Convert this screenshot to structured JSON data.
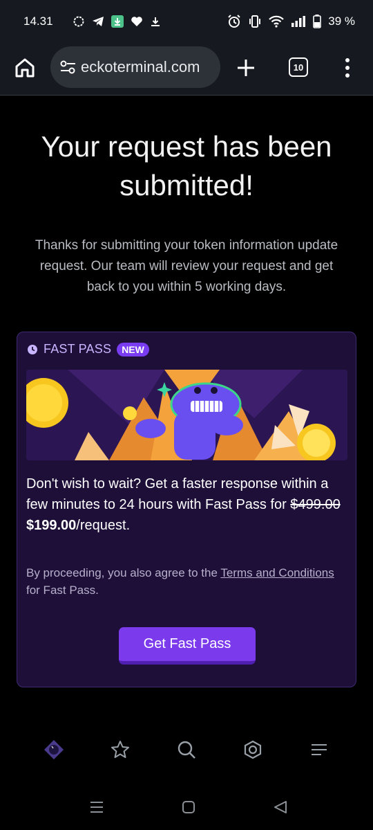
{
  "status_bar": {
    "time": "14.31",
    "battery": "39 %",
    "icons": [
      "signal-app-icon",
      "telegram-icon",
      "download-app-icon",
      "heart-icon",
      "download-icon",
      "alarm-icon",
      "vibrate-icon",
      "wifi-icon",
      "cell-signal-icon",
      "battery-icon"
    ]
  },
  "browser": {
    "url": "eckoterminal.com",
    "tab_count": "10",
    "icons": [
      "home-icon",
      "site-settings-icon",
      "new-tab-icon",
      "tabs-icon",
      "more-icon"
    ]
  },
  "main": {
    "headline": "Your request has been submitted!",
    "description": "Thanks for submitting your token information update request. Our team will review your request and get back to you within 5 working days."
  },
  "fast_pass": {
    "label": "FAST PASS",
    "badge": "NEW",
    "body_text": "Don't wish to wait? Get a faster response within a few minutes to 24 hours with Fast Pass for",
    "old_price": "$499.00",
    "new_price": "$199.00",
    "price_suffix": "/request.",
    "legal_prefix": "By proceeding, you also agree to the",
    "legal_link": "Terms and Conditions",
    "legal_suffix": "for Fast Pass.",
    "button_label": "Get Fast Pass",
    "accent_color": "#7c3aed",
    "card_color": "#1d0f38"
  },
  "site_nav": {
    "items": [
      "logo-icon",
      "star-icon",
      "search-icon",
      "coin-icon",
      "menu-icon"
    ]
  },
  "android_nav": {
    "items": [
      "recents-icon",
      "home-icon",
      "back-icon"
    ]
  }
}
